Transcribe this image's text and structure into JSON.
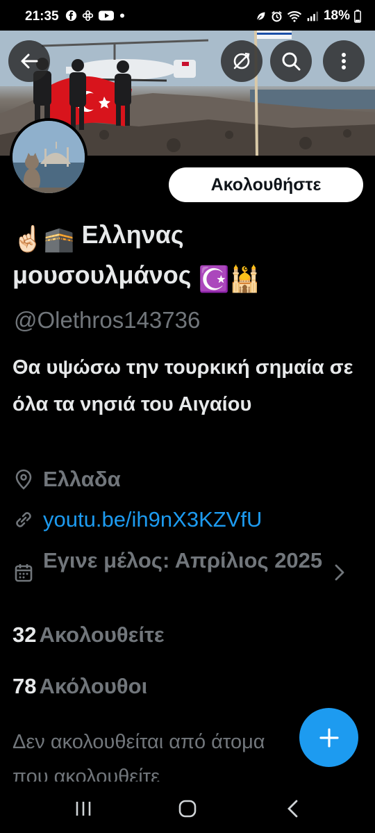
{
  "status_bar": {
    "time": "21:35",
    "battery": "18%",
    "left_icons": [
      "facebook-icon",
      "pinwheel-icon",
      "youtube-icon",
      "dot-icon"
    ],
    "right_icons": [
      "leaf-icon",
      "alarm-icon",
      "wifi-icon",
      "signal-icon",
      "battery-icon"
    ]
  },
  "header": {
    "back_icon": "arrow-left-icon",
    "mute_icon": "no-signal-icon",
    "search_icon": "search-icon",
    "more_icon": "more-vertical-icon"
  },
  "profile": {
    "follow_label": "Ακολουθήστε",
    "name_emoji_start": "☝🏻🕋",
    "name_line1": "Ελληνας",
    "name_line2": "μουσουλμάνος",
    "name_emoji_end": "☪️🕌",
    "handle": "@Olethros143736",
    "bio": "Θα υψώσω την τουρκική σημαία σε όλα τα νησιά του Αιγαίου",
    "location": "Ελλαδα",
    "link": "youtu.be/ih9nX3KZVfU",
    "joined": "Εγινε μέλος: Απρίλιος 2025"
  },
  "stats": {
    "following_count": "32",
    "following_label": "Ακολουθείτε",
    "followers_count": "78",
    "followers_label": "Ακόλουθοι"
  },
  "mutual_text": "Δεν ακολουθείται από άτομα που ακολουθείτε",
  "colors": {
    "accent": "#1d9bf0",
    "background": "#000000",
    "text_primary": "#e7e9ea",
    "text_secondary": "#71767b"
  }
}
